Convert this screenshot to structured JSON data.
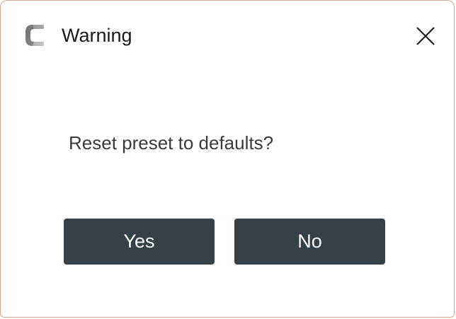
{
  "window": {
    "title": "Warning",
    "app_icon": "app-logo-icon",
    "close_icon": "close-icon"
  },
  "dialog": {
    "message": "Reset preset to defaults?",
    "buttons": {
      "yes_label": "Yes",
      "no_label": "No"
    }
  },
  "colors": {
    "border": "#d9a88e",
    "button_bg": "#354047",
    "button_text": "#ffffff",
    "message_text": "#3a3a3a"
  }
}
